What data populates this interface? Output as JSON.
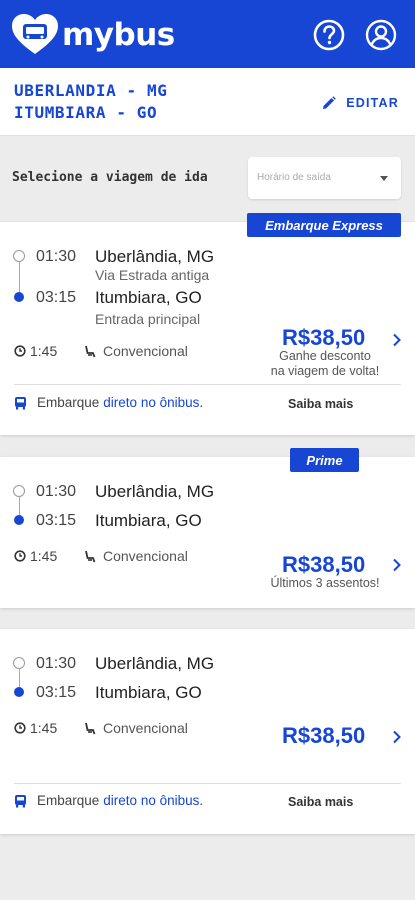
{
  "app": {
    "name": "mybus"
  },
  "header": {
    "help_icon": "help-circle-icon",
    "profile_icon": "user-circle-icon",
    "color": "#1646d3"
  },
  "route": {
    "line1": "UBERLANDIA - MG",
    "line2": "ITUMBIARA - GO",
    "edit_label": "EDITAR"
  },
  "trip_select": {
    "label": "Selecione a viagem de ida",
    "placeholder": "Horário de saída"
  },
  "trips": [
    {
      "badge": "Embarque Express",
      "departure_time": "01:30",
      "origin": "Uberlândia, MG",
      "origin_detail": "Via Estrada antiga",
      "arrival_time": "03:15",
      "destination": "Itumbiara, GO",
      "destination_detail": "Entrada principal",
      "duration": "1:45",
      "bus_type": "Convencional",
      "price": "R$38,50",
      "price_note_1": "Ganhe desconto",
      "price_note_2": "na viagem de volta!",
      "footer_text": "Embarque",
      "footer_link": "direto no ônibus.",
      "more_label": "Saiba mais"
    },
    {
      "badge": "Prime",
      "departure_time": "01:30",
      "origin": "Uberlândia, MG",
      "arrival_time": "03:15",
      "destination": "Itumbiara, GO",
      "duration": "1:45",
      "bus_type": "Convencional",
      "price": "R$38,50",
      "price_note_1": "Últimos 3 assentos!"
    },
    {
      "departure_time": "01:30",
      "origin": "Uberlândia, MG",
      "arrival_time": "03:15",
      "destination": "Itumbiara, GO",
      "duration": "1:45",
      "bus_type": "Convencional",
      "price": "R$38,50",
      "footer_text": "Embarque",
      "footer_link": "direto no ônibus.",
      "more_label": "Saiba mais"
    }
  ]
}
